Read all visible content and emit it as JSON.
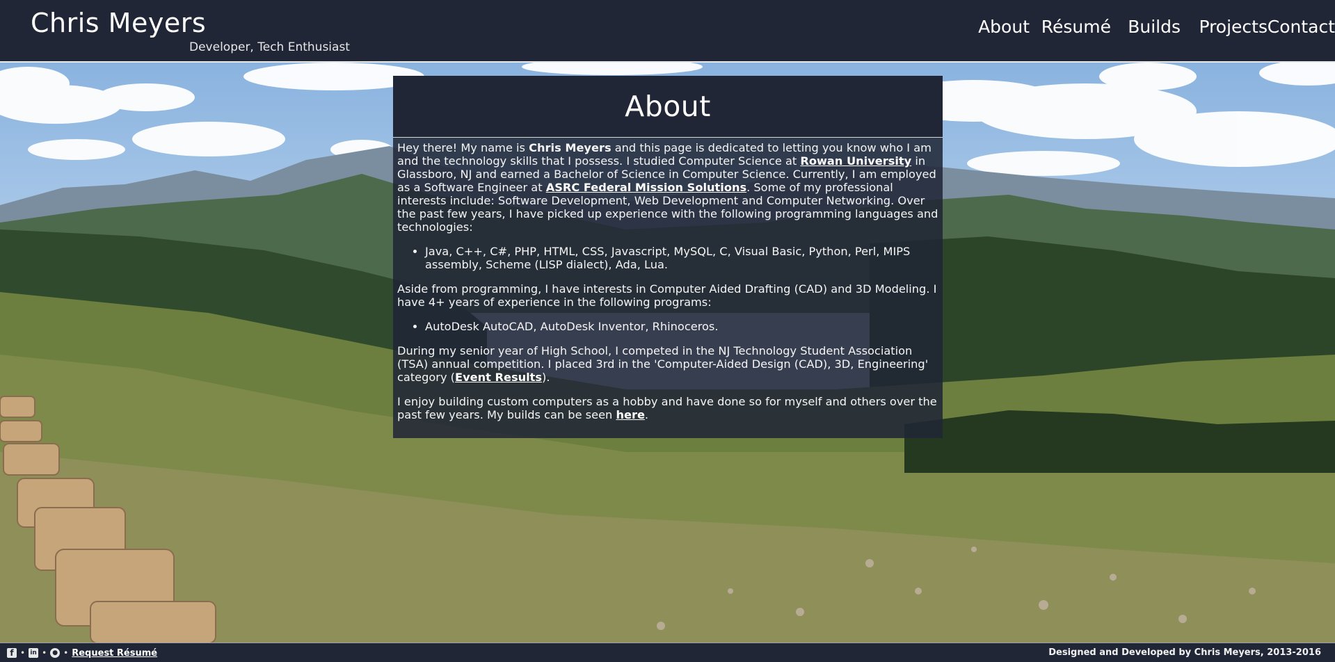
{
  "header": {
    "title": "Chris Meyers",
    "subtitle": "Developer, Tech Enthusiast",
    "nav": [
      {
        "label": "About"
      },
      {
        "label": "Résumé"
      },
      {
        "label": "Builds"
      },
      {
        "label": "Projects"
      },
      {
        "label": "Contact"
      }
    ]
  },
  "about": {
    "heading": "About",
    "p1": {
      "t1": "Hey there! My name is ",
      "name": "Chris Meyers",
      "t2": " and this page is dedicated to letting you know who I am and the technology skills that I possess. I studied Computer Science at ",
      "link1": "Rowan University",
      "t3": " in Glassboro, NJ and earned a Bachelor of Science in Computer Science. Currently, I am employed as a Software Engineer at ",
      "link2": "ASRC Federal Mission Solutions",
      "t4": ". Some of my professional interests include: Software Development, Web Development and Computer Networking. Over the past few years, I have picked up experience with the following programming languages and technologies:"
    },
    "languages": "Java, C++, C#, PHP, HTML, CSS, Javascript, MySQL, C, Visual Basic, Python, Perl, MIPS assembly, Scheme (LISP dialect), Ada, Lua.",
    "p2": "Aside from programming, I have interests in Computer Aided Drafting (CAD) and 3D Modeling. I have 4+ years of experience in the following programs:",
    "programs": "AutoDesk AutoCAD, AutoDesk Inventor, Rhinoceros.",
    "p3": {
      "t1": "During my senior year of High School, I competed in the NJ Technology Student Association (TSA) annual competition. I placed 3rd in the 'Computer-Aided Design (CAD), 3D, Engineering' category (",
      "link": "Event Results",
      "t2": ")."
    },
    "p4": {
      "t1": "I enjoy building custom computers as a hobby and have done so for myself and others over the past few years. My builds can be seen ",
      "link": "here",
      "t2": "."
    }
  },
  "footer": {
    "icons": [
      "facebook-icon",
      "linkedin-icon",
      "github-icon"
    ],
    "facebook_glyph": "f",
    "linkedin_glyph": "in",
    "github_glyph": "●",
    "separator": "•",
    "request_resume": "Request Résumé",
    "credit": "Designed and Developed by Chris Meyers, 2013-2016"
  },
  "colors": {
    "header_bg": "#202636",
    "panel_bg": "#1f2535",
    "text": "#ffffff"
  }
}
